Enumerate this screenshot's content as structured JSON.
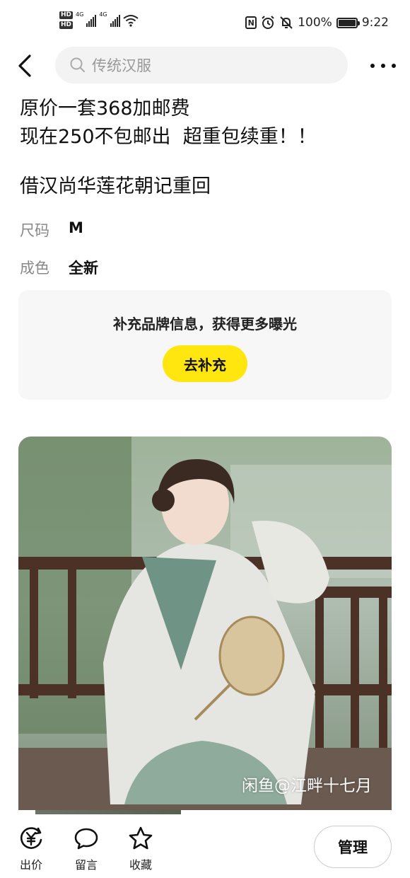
{
  "status_bar": {
    "hd1": "HD",
    "hd2": "HD",
    "net1": "4G",
    "net2": "4G",
    "nfc": "N",
    "battery_percent": "100%",
    "battery_level": 1.0,
    "time": "9:22"
  },
  "header": {
    "search_placeholder": "传统汉服"
  },
  "item": {
    "desc_line1": "原价一套368加邮费",
    "desc_line2": "现在250不包邮出  超重包续重！！",
    "desc_line3": "借汉尚华莲花朝记重回",
    "attributes": [
      {
        "key": "尺码",
        "value": "M"
      },
      {
        "key": "成色",
        "value": "全新"
      }
    ]
  },
  "promo": {
    "text": "补充品牌信息，获得更多曝光",
    "button_label": "去补充",
    "button_color": "#ffe60f"
  },
  "photo": {
    "watermark": "闲鱼@江畔十七月"
  },
  "bottom_bar": {
    "actions": [
      {
        "label": "出价",
        "icon": "yuan-price-icon"
      },
      {
        "label": "留言",
        "icon": "chat-bubble-icon"
      },
      {
        "label": "收藏",
        "icon": "star-icon"
      }
    ],
    "manage_label": "管理"
  }
}
